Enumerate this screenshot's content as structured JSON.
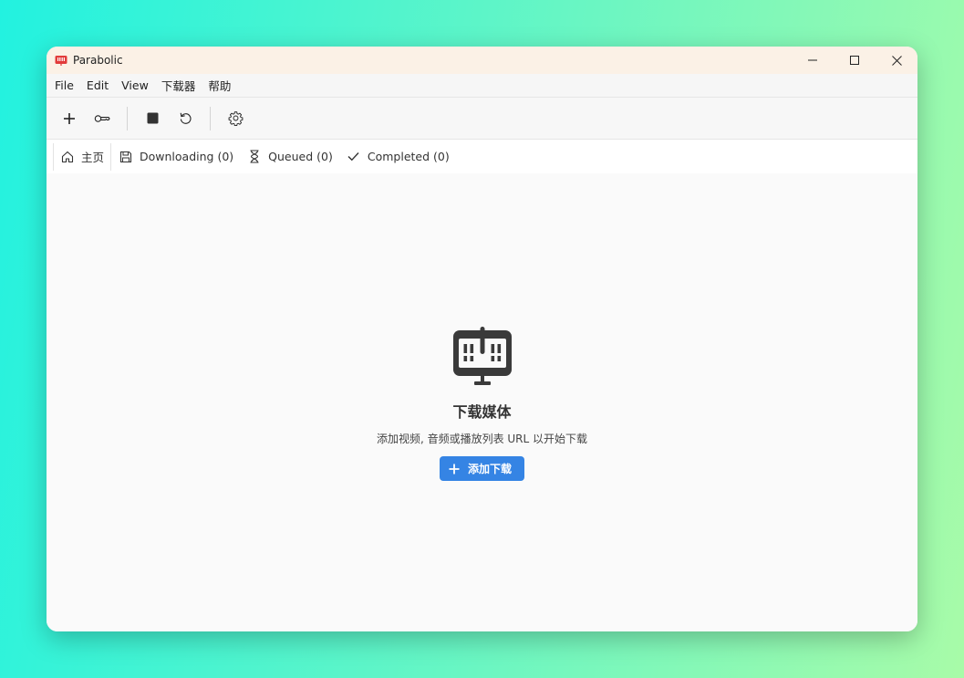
{
  "window": {
    "title": "Parabolic"
  },
  "menu": [
    "File",
    "Edit",
    "View",
    "下载器",
    "帮助"
  ],
  "tabs": [
    {
      "label": "主页",
      "icon": "home-icon",
      "active": true
    },
    {
      "label": "Downloading (0)",
      "icon": "save-icon",
      "active": false
    },
    {
      "label": "Queued (0)",
      "icon": "hourglass-icon",
      "active": false
    },
    {
      "label": "Completed (0)",
      "icon": "checkmark-icon",
      "active": false
    }
  ],
  "empty_state": {
    "icon": "parabolic-logo-icon",
    "title": "下载媒体",
    "description": "添加视频, 音频或播放列表 URL 以开始下载",
    "button_label": "添加下载"
  },
  "colors": {
    "accent": "#3584e4",
    "titlebar": "#fbf1e6",
    "icon_dark": "#3a3a3a"
  }
}
